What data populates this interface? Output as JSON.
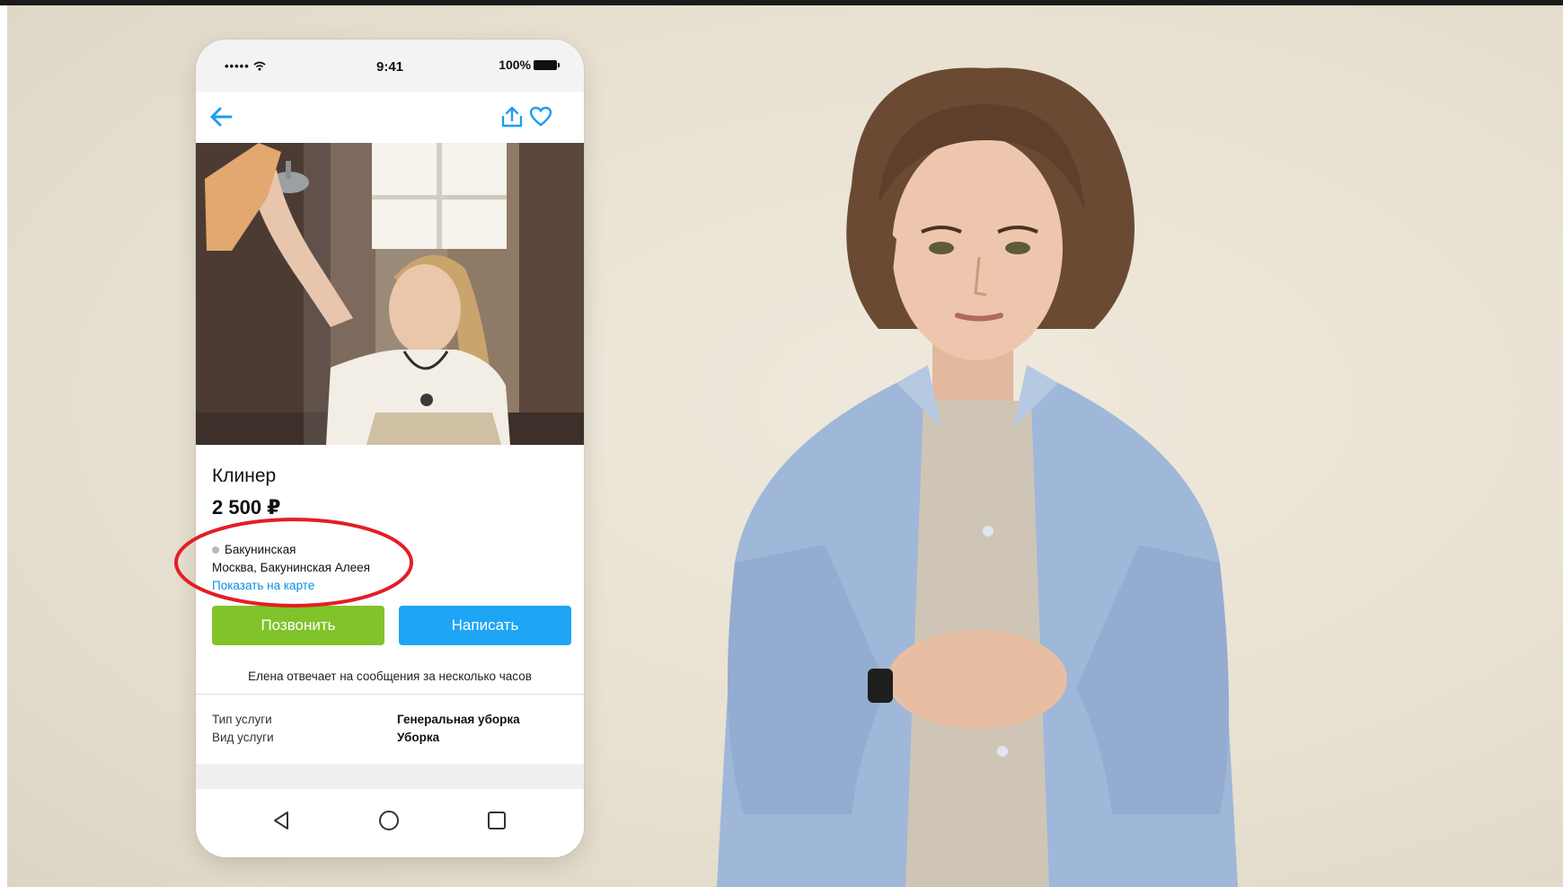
{
  "status_bar": {
    "signal": "••••• ",
    "time": "9:41",
    "battery": "100%"
  },
  "listing": {
    "title": "Клинер",
    "price": "2 500 ₽",
    "metro": "Бакунинская",
    "address": "Москва, Бакунинская Алеея",
    "map_link": "Показать на карте"
  },
  "actions": {
    "call": "Позвонить",
    "write": "Написать"
  },
  "reply_note": "Елена отвечает на сообщения за несколько часов",
  "params": [
    {
      "name": "Тип услуги",
      "value": "Генеральная уборка"
    },
    {
      "name": "Вид услуги",
      "value": "Уборка"
    }
  ],
  "colors": {
    "accent_blue": "#1ea5f5",
    "call_green": "#81c32a",
    "link_blue": "#0a8fe0",
    "highlight_red": "#e31e24",
    "background": "#e9e3d6"
  },
  "icons": [
    "back-arrow-icon",
    "share-icon",
    "heart-icon",
    "wifi-icon",
    "battery-icon",
    "nav-back-icon",
    "nav-home-icon",
    "nav-recents-icon"
  ]
}
